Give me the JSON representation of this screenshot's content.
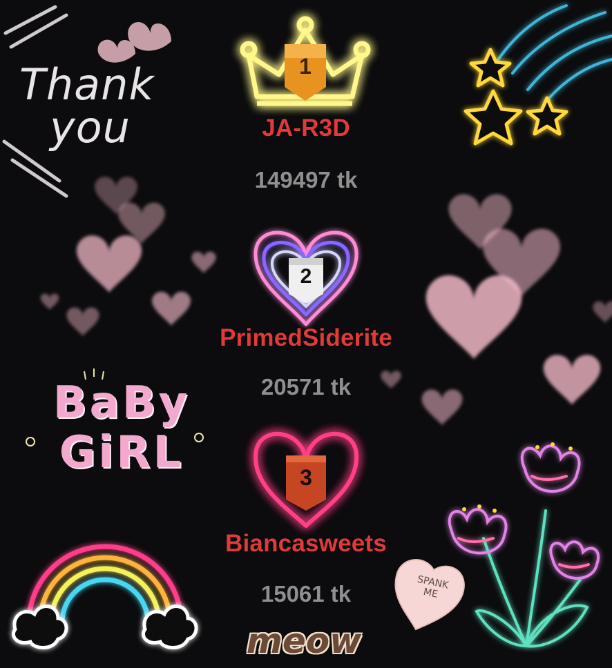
{
  "colors": {
    "background": "#0c0c0e",
    "name": "#e03a3a",
    "score": "#8f8f8f",
    "gold": "#ffd23a",
    "pink": "#ff5fa8",
    "purple": "#7f5cff"
  },
  "leaderboard": [
    {
      "rank": "1",
      "name": "JA-R3D",
      "score": "149497 tk",
      "badge_icon": "crown-icon"
    },
    {
      "rank": "2",
      "name": "PrimedSiderite",
      "score": "20571 tk",
      "badge_icon": "layered-heart-icon"
    },
    {
      "rank": "3",
      "name": "Biancasweets",
      "score": "15061 tk",
      "badge_icon": "neon-heart-icon"
    }
  ],
  "decorations": {
    "thank_you": [
      "Thank",
      "you"
    ],
    "baby_girl": [
      "BaBy",
      "GiRL"
    ],
    "candy_heart": [
      "SPANK",
      "ME"
    ],
    "meow": "meow",
    "icons": [
      "stars-icon",
      "rainbow-icon",
      "flowers-icon",
      "hearts-icon",
      "chalk-hearts-icon"
    ]
  }
}
